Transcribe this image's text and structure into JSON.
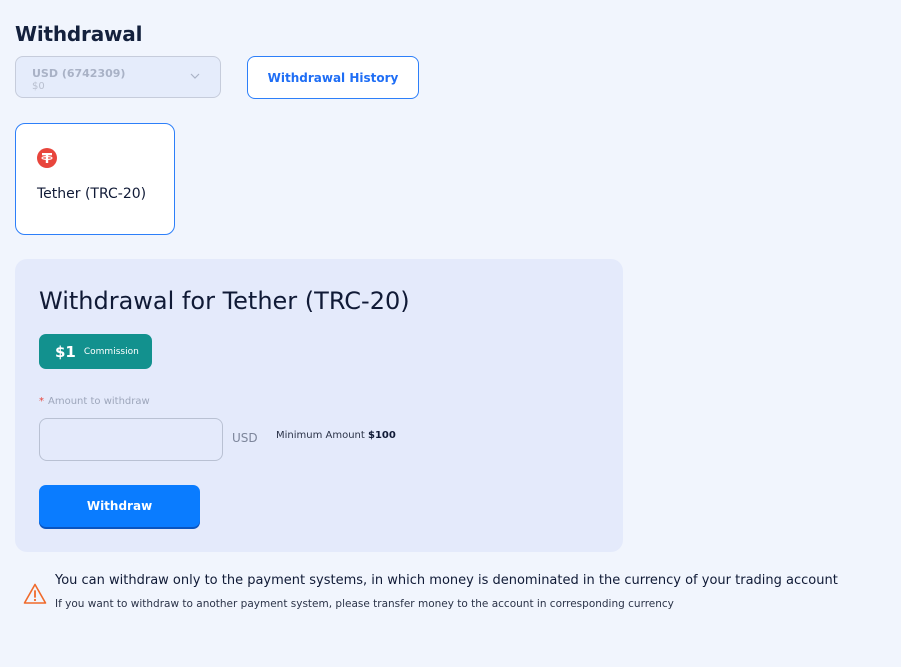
{
  "page": {
    "title": "Withdrawal"
  },
  "account": {
    "name": "USD (6742309)",
    "balance": "$0"
  },
  "history_button_label": "Withdrawal History",
  "methods": [
    {
      "label": "Tether (TRC-20)",
      "icon": "tether-icon",
      "selected": true
    }
  ],
  "panel": {
    "title": "Withdrawal for Tether (TRC-20)",
    "commission_amount": "$1",
    "commission_label": "Commission",
    "required_mark": "*",
    "amount_label": "Amount to withdraw",
    "amount_value": "",
    "currency": "USD",
    "min_amount_label": "Minimum Amount",
    "min_amount_value": "$100",
    "withdraw_label": "Withdraw"
  },
  "notice": {
    "icon": "warning-icon",
    "main": "You can withdraw only to the payment systems, in which money is denominated in the currency of your trading account",
    "sub": "If you want to withdraw to another payment system, please transfer money to the account in corresponding currency"
  },
  "colors": {
    "accent": "#0a7cff",
    "commission": "#12918e",
    "tether": "#e8453c",
    "warning": "#f06a2b"
  }
}
